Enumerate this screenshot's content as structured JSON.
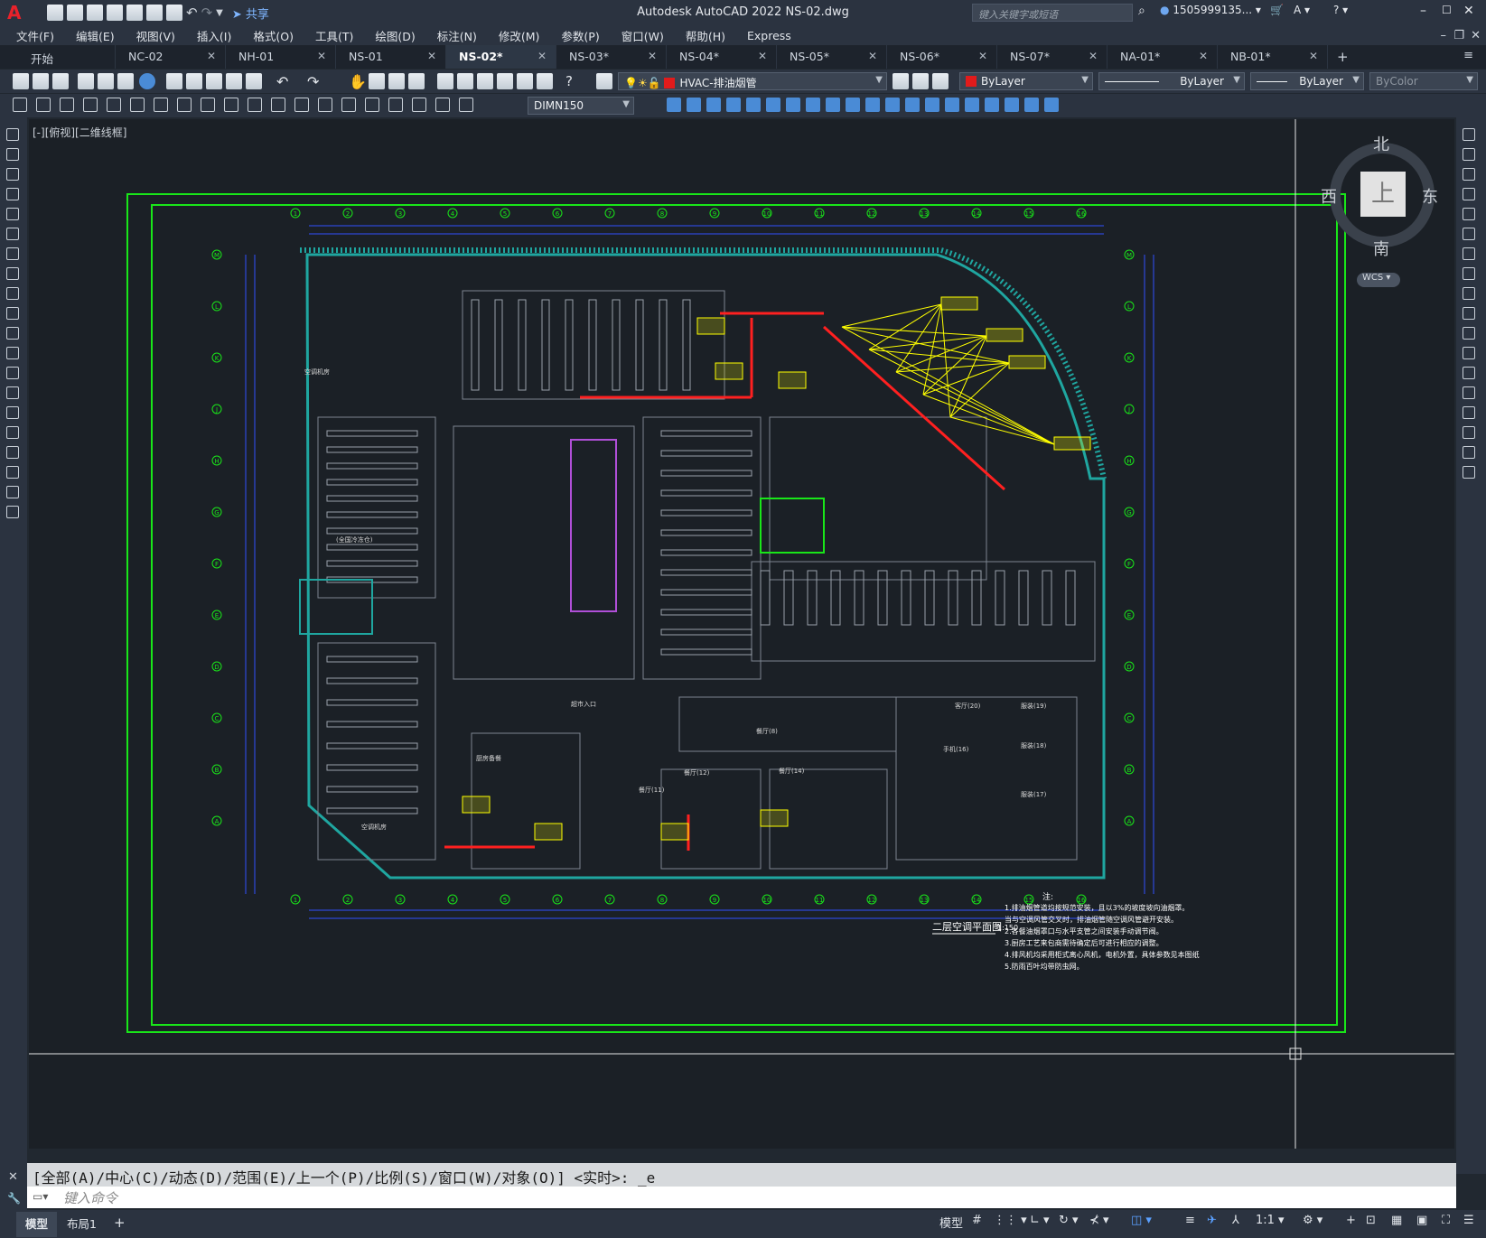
{
  "app": {
    "title": "Autodesk AutoCAD 2022    NS-02.dwg",
    "share_label": "共享",
    "search_placeholder": "键入关键字或短语",
    "user": "1505999135...",
    "logo": "A"
  },
  "menu": [
    "文件(F)",
    "编辑(E)",
    "视图(V)",
    "插入(I)",
    "格式(O)",
    "工具(T)",
    "绘图(D)",
    "标注(N)",
    "修改(M)",
    "参数(P)",
    "窗口(W)",
    "帮助(H)",
    "Express"
  ],
  "tabs": [
    {
      "label": "开始",
      "active": false,
      "closable": false
    },
    {
      "label": "NC-02",
      "active": false,
      "closable": true
    },
    {
      "label": "NH-01",
      "active": false,
      "closable": true
    },
    {
      "label": "NS-01",
      "active": false,
      "closable": true
    },
    {
      "label": "NS-02*",
      "active": true,
      "closable": true
    },
    {
      "label": "NS-03*",
      "active": false,
      "closable": true
    },
    {
      "label": "NS-04*",
      "active": false,
      "closable": true
    },
    {
      "label": "NS-05*",
      "active": false,
      "closable": true
    },
    {
      "label": "NS-06*",
      "active": false,
      "closable": true
    },
    {
      "label": "NS-07*",
      "active": false,
      "closable": true
    },
    {
      "label": "NA-01*",
      "active": false,
      "closable": true
    },
    {
      "label": "NB-01*",
      "active": false,
      "closable": true
    }
  ],
  "toolbar": {
    "layer": "HVAC-排油烟管",
    "color": "ByLayer",
    "linetype": "ByLayer",
    "lineweight": "ByLayer",
    "plotstyle": "ByColor",
    "dimstyle": "DIMN150"
  },
  "viewport": {
    "label": "[-][俯视][二维线框]",
    "viewcube": {
      "north": "北",
      "south": "南",
      "east": "东",
      "west": "西",
      "top": "上"
    },
    "wcs": "WCS"
  },
  "drawing": {
    "title": "二层空调平面图",
    "scale": "1:150",
    "notes_heading": "注:",
    "notes": [
      "1.排油烟管道均按规范安装，且以3%的坡度坡向油烟罩。",
      "  当与空调风管交叉时，排油烟管随空调风管避开安装。",
      "2.各餐油烟罩口与水平支管之间安装手动调节阀。",
      "3.厨房工艺来包商需待确定后可进行相应的调整。",
      "4.排风机均采用柜式离心风机，电机外置，具体参数见本图纸",
      "5.防雨百叶均带防虫网。"
    ],
    "grid_top": [
      "1",
      "2",
      "3",
      "4",
      "5",
      "6",
      "7",
      "8",
      "9",
      "10",
      "11",
      "12",
      "13",
      "14",
      "15",
      "16"
    ],
    "grid_side": [
      "M",
      "L",
      "K",
      "J",
      "H",
      "G",
      "F",
      "E",
      "D",
      "C",
      "B",
      "A"
    ],
    "room_labels": [
      "空调机房",
      "超市入口",
      "厨房备餐",
      "空调机房",
      "餐厅(8)",
      "餐厅(12)",
      "餐厅(14)",
      "手机(16)",
      "餐厅(11)",
      "(全国冷冻仓)",
      "客厅(20)",
      "服装(18)",
      "服装(19)",
      "服装(17)"
    ]
  },
  "command": {
    "history": "[全部(A)/中心(C)/动态(D)/范围(E)/上一个(P)/比例(S)/窗口(W)/对象(O)] <实时>: _e",
    "placeholder": "键入命令"
  },
  "status": {
    "layouts": [
      "模型",
      "布局1"
    ],
    "model_label": "模型",
    "scale": "1:1"
  },
  "colors": {
    "background": "#1b2026",
    "wall": "#1fa6a0",
    "grid": "#3050ff",
    "hvac": "#ffff00",
    "duct_red": "#ff2020",
    "frame": "#19e619"
  }
}
